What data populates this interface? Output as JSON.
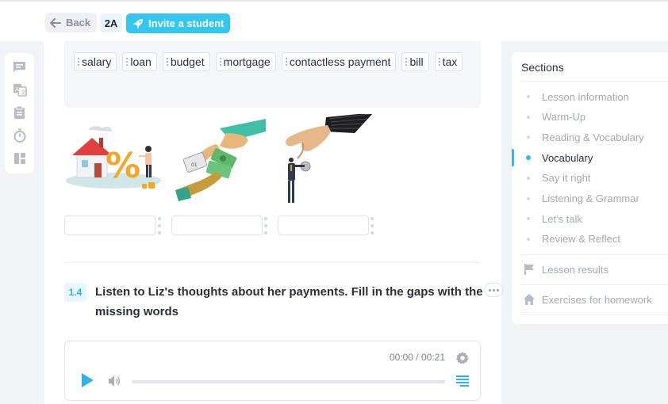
{
  "topbar": {
    "back_label": "Back",
    "class_code": "2A",
    "invite_label": "Invite a student"
  },
  "word_bank": {
    "chips": [
      "salary",
      "loan",
      "budget",
      "mortgage",
      "contactless payment",
      "bill",
      "tax"
    ]
  },
  "pictures": [
    {
      "icon": "house-with-percent-sign",
      "answer": ""
    },
    {
      "icon": "hands-exchanging-cash-and-card",
      "answer": ""
    },
    {
      "icon": "giant-hand-giving-coin-to-businessman",
      "answer": ""
    }
  ],
  "exercise": {
    "number": "1.4",
    "title": "Listen to Liz's thoughts about her payments. Fill in the gaps with the missing words"
  },
  "player": {
    "time": "00:00 / 00:21",
    "progress": 0
  },
  "sections": {
    "title": "Sections",
    "items": [
      {
        "label": "Lesson information",
        "active": false
      },
      {
        "label": "Warm-Up",
        "active": false
      },
      {
        "label": "Reading & Vocabulary",
        "active": false
      },
      {
        "label": "Vocabulary",
        "active": true
      },
      {
        "label": "Say it right",
        "active": false
      },
      {
        "label": "Listening & Grammar",
        "active": false
      },
      {
        "label": "Let's talk",
        "active": false
      },
      {
        "label": "Review & Reflect",
        "active": false
      }
    ],
    "lesson_results": "Lesson results",
    "homework": "Exercises for homework"
  },
  "colors": {
    "accent": "#33c7f0",
    "active_dot": "#33b7ea",
    "exercise_number": "#26b3e6"
  }
}
